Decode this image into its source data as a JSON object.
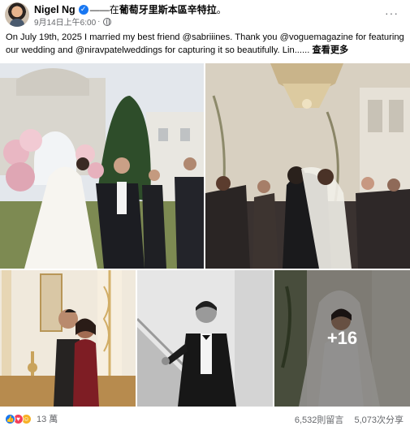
{
  "post": {
    "author": "Nigel Ng",
    "location_prefix": "——在",
    "location": "葡萄牙里斯本區辛特拉",
    "location_suffix": "。",
    "timestamp": "9月14日上午6:00",
    "more_label": "···",
    "caption": "On July 19th, 2025 I married my best friend @sabriiines. Thank you @voguemagazine for featuring our wedding and @niravpatelweddings for capturing it so beautifully. Lin......",
    "see_more": "查看更多",
    "extra_photos": "+16"
  },
  "footer": {
    "reactions_count": "13 萬",
    "comments": "6,532則留言",
    "shares": "5,073次分享"
  },
  "colors": {
    "accent": "#1877f2",
    "secondary_text": "#65676b"
  },
  "icons": [
    "avatar",
    "verified-badge-icon",
    "globe-icon",
    "more-options-icon",
    "like-reaction-icon",
    "love-reaction-icon",
    "care-reaction-icon"
  ]
}
